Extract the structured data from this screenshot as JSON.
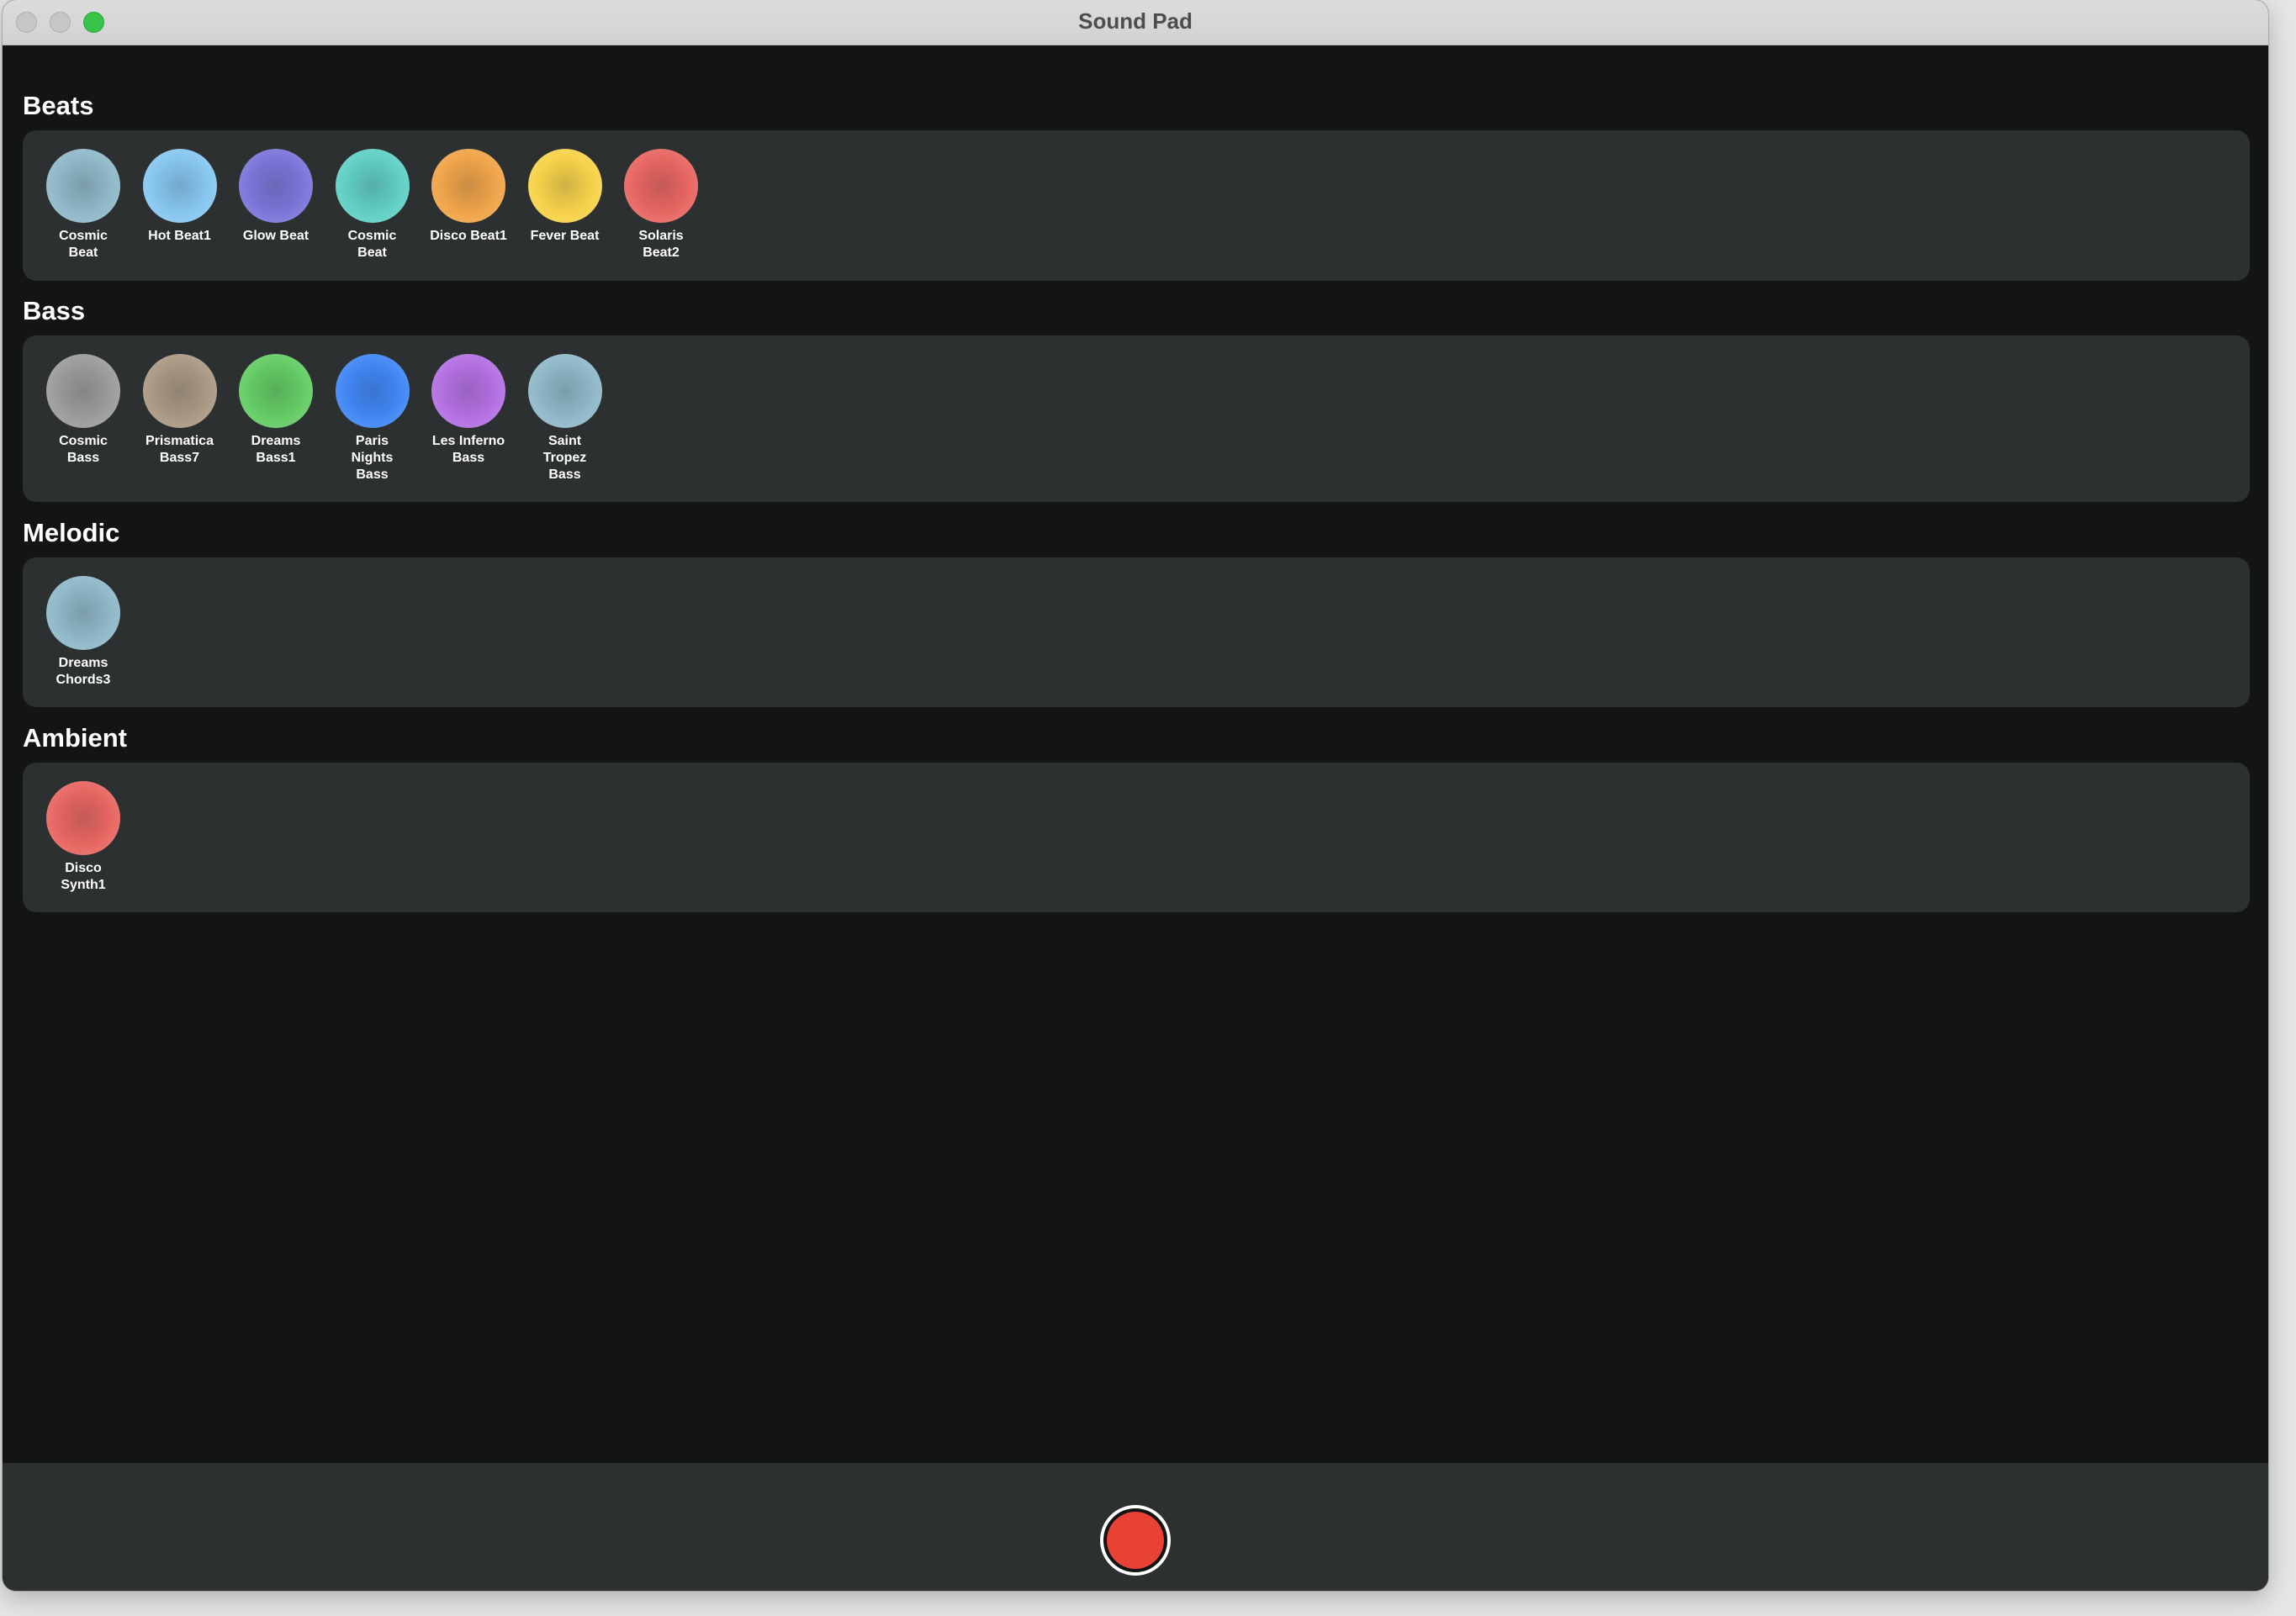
{
  "window": {
    "title": "Sound Pad"
  },
  "sections": [
    {
      "title": "Beats",
      "pads": [
        {
          "label": "Cosmic\nBeat",
          "color": "#8fb8c8"
        },
        {
          "label": "Hot Beat1",
          "color": "#86c6f0"
        },
        {
          "label": "Glow Beat",
          "color": "#7a74d8"
        },
        {
          "label": "Cosmic\nBeat",
          "color": "#5fcfc4"
        },
        {
          "label": "Disco Beat1",
          "color": "#f0a448"
        },
        {
          "label": "Fever Beat",
          "color": "#f7d248"
        },
        {
          "label": "Solaris\nBeat2",
          "color": "#e86560"
        }
      ]
    },
    {
      "title": "Bass",
      "pads": [
        {
          "label": "Cosmic\nBass",
          "color": "#9b9b9b"
        },
        {
          "label": "Prismatica\nBass7",
          "color": "#a99882"
        },
        {
          "label": "Dreams\nBass1",
          "color": "#63cc63"
        },
        {
          "label": "Paris\nNights\nBass",
          "color": "#3f86f5"
        },
        {
          "label": "Les Inferno\nBass",
          "color": "#b46fe2"
        },
        {
          "label": "Saint\nTropez\nBass",
          "color": "#8fb8c8"
        }
      ]
    },
    {
      "title": "Melodic",
      "pads": [
        {
          "label": "Dreams\nChords3",
          "color": "#8fb8c8"
        }
      ]
    },
    {
      "title": "Ambient",
      "pads": [
        {
          "label": "Disco\nSynth1",
          "color": "#e86560"
        }
      ]
    }
  ],
  "colors": {
    "background": "#131414",
    "panel": "#2d3031",
    "record": "#e84236"
  },
  "icons": {
    "record": "record-icon"
  }
}
